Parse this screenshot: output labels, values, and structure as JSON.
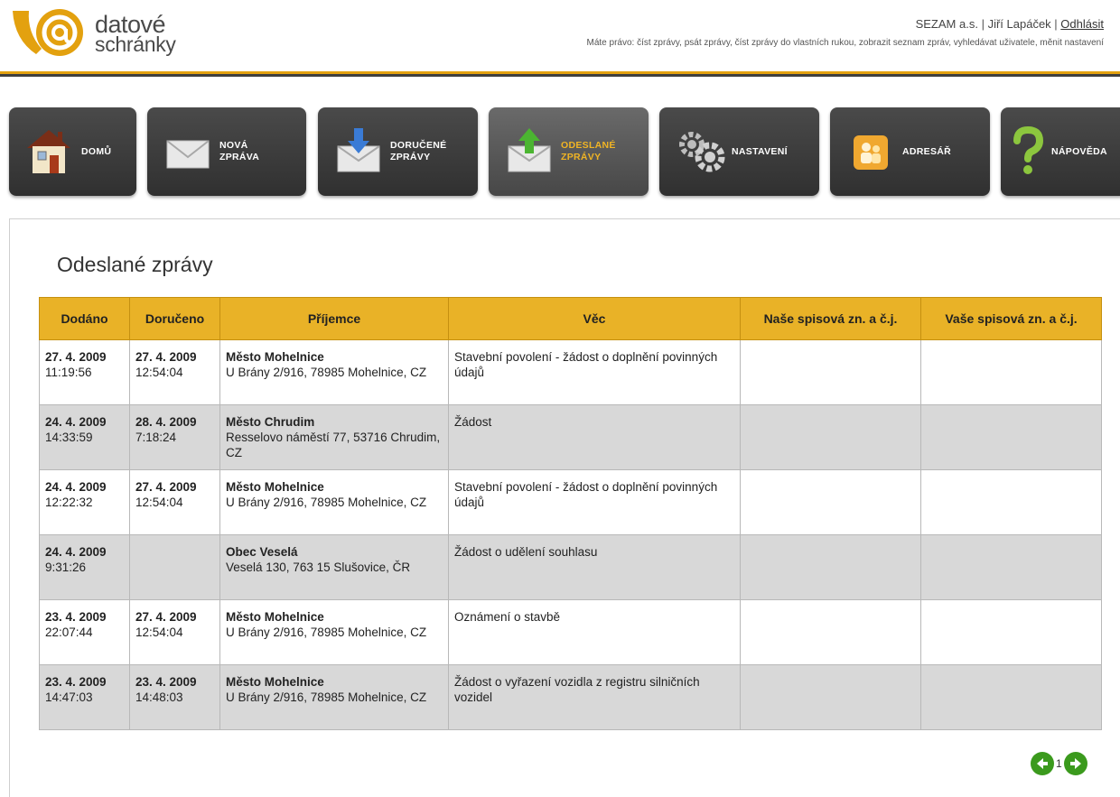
{
  "brand": {
    "line1": "datové",
    "line2": "schránky",
    "colors": {
      "primary": "#e3a10f",
      "dark": "#3f3f3f"
    }
  },
  "user": {
    "organization": "SEZAM a.s.",
    "name": "Jiří Lapáček",
    "logout": "Odhlásit",
    "rights": "Máte právo: číst zprávy, psát zprávy, číst zprávy do vlastních rukou, zobrazit seznam zpráv, vyhledávat uživatele, měnit nastavení"
  },
  "nav": [
    {
      "l1": "DOMŮ",
      "l2": "",
      "icon": "house-icon"
    },
    {
      "l1": "NOVÁ",
      "l2": "ZPRÁVA",
      "icon": "envelope-icon"
    },
    {
      "l1": "DORUČENÉ",
      "l2": "ZPRÁVY",
      "icon": "inbox-icon"
    },
    {
      "l1": "ODESLANÉ",
      "l2": "ZPRÁVY",
      "icon": "outbox-icon",
      "active": true
    },
    {
      "l1": "NASTAVENÍ",
      "l2": "",
      "icon": "gears-icon"
    },
    {
      "l1": "ADRESÁŘ",
      "l2": "",
      "icon": "contacts-icon"
    },
    {
      "l1": "NÁPOVĚDA",
      "l2": "",
      "icon": "help-icon"
    }
  ],
  "page_title": "Odeslané zprávy",
  "table": {
    "headers": [
      "Dodáno",
      "Doručeno",
      "Příjemce",
      "Věc",
      "Naše spisová zn. a č.j.",
      "Vaše spisová zn. a č.j."
    ],
    "rows": [
      {
        "sent_date": "27. 4. 2009",
        "sent_time": "11:19:56",
        "deliv_date": "27. 4. 2009",
        "deliv_time": "12:54:04",
        "recipient": "Město Mohelnice",
        "address": "U Brány 2/916, 78985 Mohelnice, CZ",
        "subject": "Stavební povolení - žádost o doplnění povinných údajů",
        "our_ref": "",
        "your_ref": ""
      },
      {
        "sent_date": "24. 4. 2009",
        "sent_time": "14:33:59",
        "deliv_date": "28. 4. 2009",
        "deliv_time": "7:18:24",
        "recipient": "Město Chrudim",
        "address": "Resselovo náměstí 77, 53716 Chrudim, CZ",
        "subject": "Žádost",
        "our_ref": "",
        "your_ref": ""
      },
      {
        "sent_date": "24. 4. 2009",
        "sent_time": "12:22:32",
        "deliv_date": "27. 4. 2009",
        "deliv_time": "12:54:04",
        "recipient": "Město Mohelnice",
        "address": "U Brány 2/916, 78985 Mohelnice, CZ",
        "subject": "Stavební povolení - žádost o doplnění povinných údajů",
        "our_ref": "",
        "your_ref": ""
      },
      {
        "sent_date": "24. 4. 2009",
        "sent_time": "9:31:26",
        "deliv_date": "",
        "deliv_time": "",
        "recipient": "Obec Veselá",
        "address": "Veselá 130, 763 15 Slušovice, ČR",
        "subject": "Žádost o udělení souhlasu",
        "our_ref": "",
        "your_ref": ""
      },
      {
        "sent_date": "23. 4. 2009",
        "sent_time": "22:07:44",
        "deliv_date": "27. 4. 2009",
        "deliv_time": "12:54:04",
        "recipient": "Město Mohelnice",
        "address": "U Brány 2/916, 78985 Mohelnice, CZ",
        "subject": "Oznámení o stavbě",
        "our_ref": "",
        "your_ref": ""
      },
      {
        "sent_date": "23. 4. 2009",
        "sent_time": "14:47:03",
        "deliv_date": "23. 4. 2009",
        "deliv_time": "14:48:03",
        "recipient": "Město Mohelnice",
        "address": "U Brány 2/916, 78985 Mohelnice, CZ",
        "subject": "Žádost o vyřazení vozidla z registru silničních vozidel",
        "our_ref": "",
        "your_ref": ""
      }
    ]
  },
  "pager": {
    "current": "1"
  }
}
